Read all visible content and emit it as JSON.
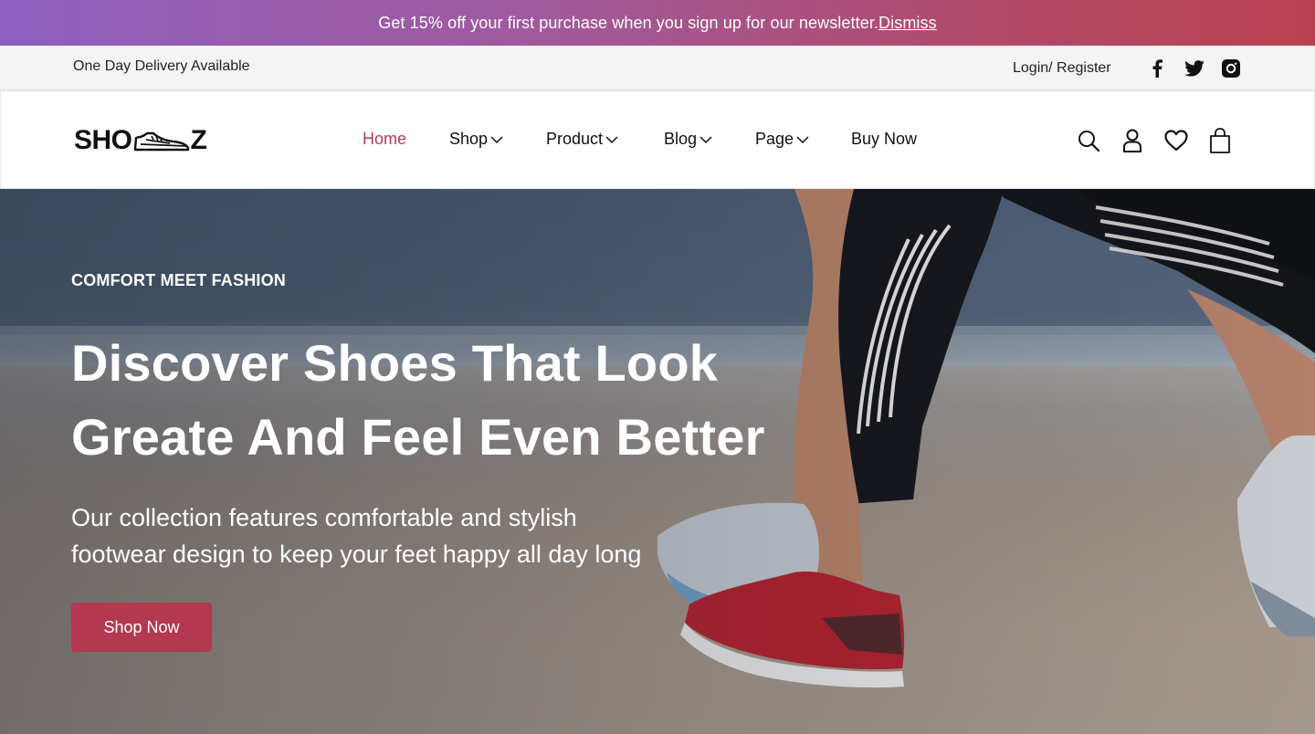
{
  "promo": {
    "message": "Get 15% off your first purchase when you sign up for our newsletter.",
    "dismiss_label": "Dismiss"
  },
  "utility": {
    "delivery_text": "One Day Delivery Available",
    "login_label": "Login/ Register",
    "social_icons": [
      "facebook-icon",
      "twitter-icon",
      "instagram-icon"
    ]
  },
  "header": {
    "logo_text_left": "SHO",
    "logo_text_right": "Z",
    "nav": [
      {
        "label": "Home",
        "active": true,
        "has_dropdown": false
      },
      {
        "label": "Shop",
        "active": false,
        "has_dropdown": true
      },
      {
        "label": "Product",
        "active": false,
        "has_dropdown": true
      },
      {
        "label": "Blog",
        "active": false,
        "has_dropdown": true
      },
      {
        "label": "Page",
        "active": false,
        "has_dropdown": true
      },
      {
        "label": "Buy Now",
        "active": false,
        "has_dropdown": false
      }
    ],
    "action_icons": [
      "search-icon",
      "user-icon",
      "heart-icon",
      "shopping-bag-icon"
    ]
  },
  "hero": {
    "eyebrow": "COMFORT MEET FASHION",
    "headline_line1": "Discover Shoes That Look",
    "headline_line2": "Greate And Feel Even Better",
    "subtext_line1": "Our collection features comfortable and stylish",
    "subtext_line2": "footwear design to keep your feet happy all day long",
    "cta_label": "Shop Now"
  },
  "colors": {
    "accent": "#b4384f",
    "nav_active": "#b03a5a",
    "promo_gradient_start": "#8e5fbf",
    "promo_gradient_end": "#b84150"
  }
}
